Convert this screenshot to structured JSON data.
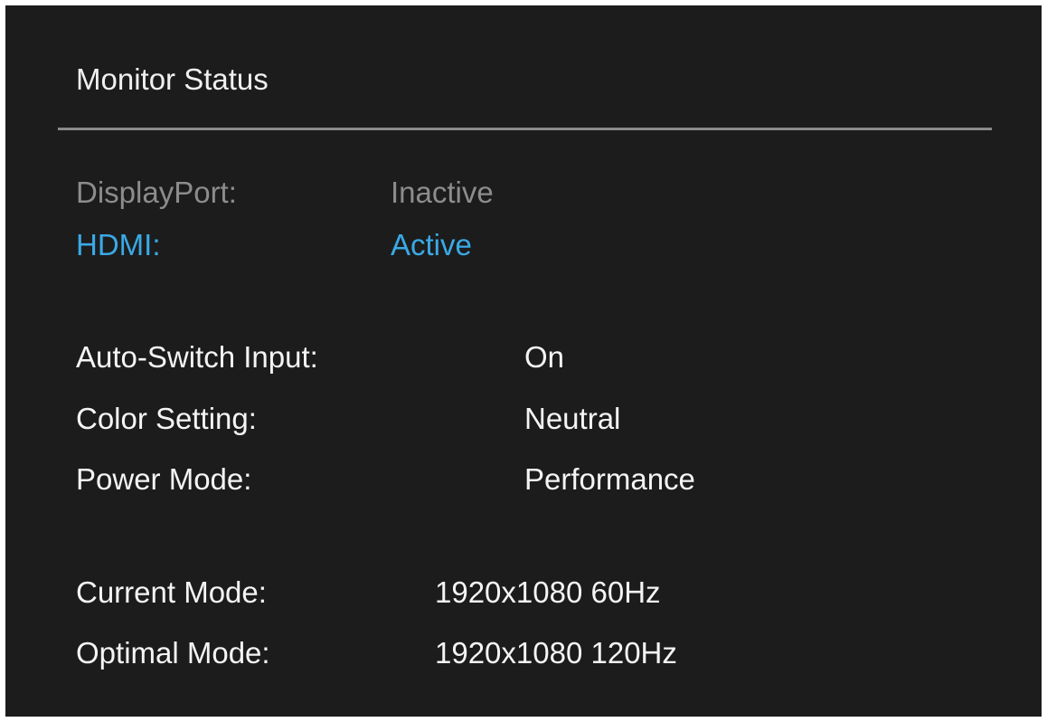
{
  "panel": {
    "title": "Monitor Status"
  },
  "inputs": [
    {
      "label": "DisplayPort:",
      "value": "Inactive",
      "state": "inactive"
    },
    {
      "label": "HDMI:",
      "value": "Active",
      "state": "active"
    }
  ],
  "settings": [
    {
      "label": "Auto-Switch Input:",
      "value": "On"
    },
    {
      "label": "Color Setting:",
      "value": "Neutral"
    },
    {
      "label": "Power Mode:",
      "value": "Performance"
    }
  ],
  "modes": [
    {
      "label": "Current Mode:",
      "value": "1920x1080 60Hz"
    },
    {
      "label": "Optimal Mode:",
      "value": "1920x1080 120Hz"
    }
  ],
  "colors": {
    "background": "#1c1c1c",
    "divider": "#8a8a8a",
    "inactive_text": "#8c8c8c",
    "active_text": "#3aa9e6",
    "normal_text": "#f4f4f4"
  }
}
